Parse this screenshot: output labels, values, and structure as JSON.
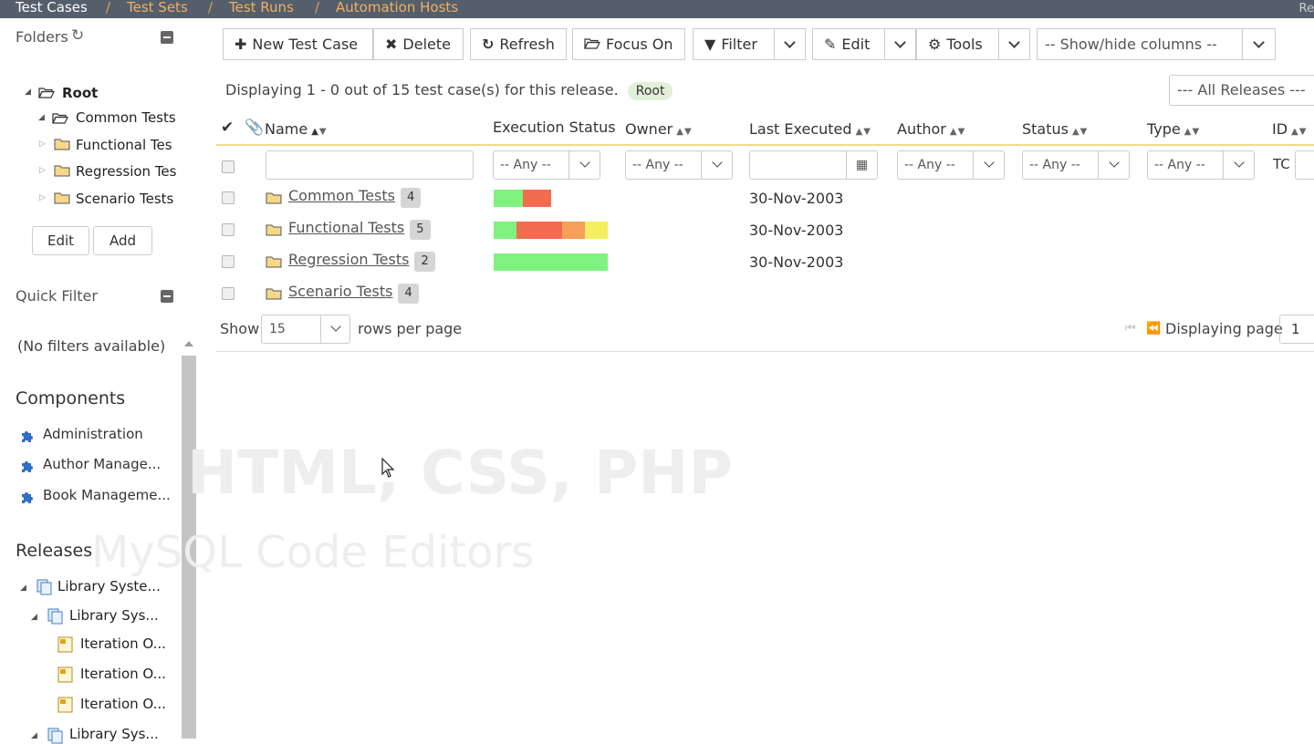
{
  "topnav": {
    "items": [
      "Test Cases",
      "Test Sets",
      "Test Runs",
      "Automation Hosts"
    ],
    "separator": "/",
    "right_text": "Re"
  },
  "sidebar": {
    "folders_title": "Folders",
    "refresh_glyph": "↻",
    "tree": [
      {
        "label": "Root"
      },
      {
        "label": "Common Tests"
      },
      {
        "label": "Functional Tes"
      },
      {
        "label": "Regression Tes"
      },
      {
        "label": "Scenario Tests"
      }
    ],
    "edit_label": "Edit",
    "add_label": "Add",
    "quick_filter_title": "Quick Filter",
    "no_filters": "(No filters available)",
    "components_title": "Components",
    "components": [
      "Administration",
      "Author Manage...",
      "Book Manageme..."
    ],
    "releases_title": "Releases",
    "releases": [
      "Library Syste...",
      "Library Sys...",
      "Iteration O...",
      "Iteration O...",
      "Iteration O...",
      "Library Sys..."
    ]
  },
  "toolbar": {
    "new_test_case": "New Test Case",
    "delete": "Delete",
    "refresh": "Refresh",
    "focus_on": "Focus On",
    "filter": "Filter",
    "edit": "Edit",
    "tools": "Tools",
    "show_hide": "-- Show/hide columns --"
  },
  "summary": {
    "text": "Displaying 1 - 0 out of 15 test case(s) for this release.",
    "root_badge": "Root",
    "releases_select": "--- All Releases ---"
  },
  "grid": {
    "columns": {
      "name": "Name",
      "execution_status": "Execution Status",
      "owner": "Owner",
      "last_executed": "Last Executed",
      "author": "Author",
      "status": "Status",
      "type": "Type",
      "id": "ID"
    },
    "filters": {
      "any": "-- Any --",
      "id_prefix": "TC"
    },
    "rows": [
      {
        "name": "Common Tests",
        "count": "4",
        "last_executed": "30-Nov-2003"
      },
      {
        "name": "Functional Tests",
        "count": "5",
        "last_executed": "30-Nov-2003"
      },
      {
        "name": "Regression Tests",
        "count": "2",
        "last_executed": "30-Nov-2003"
      },
      {
        "name": "Scenario Tests",
        "count": "4",
        "last_executed": ""
      }
    ]
  },
  "execution_status_shares": [
    [
      {
        "status": "passed",
        "share": 0.5
      },
      {
        "status": "failed",
        "share": 0.5
      }
    ],
    [
      {
        "status": "passed",
        "share": 0.2
      },
      {
        "status": "failed",
        "share": 0.4
      },
      {
        "status": "caution",
        "share": 0.2
      },
      {
        "status": "blocked",
        "share": 0.2
      }
    ],
    [
      {
        "status": "passed",
        "share": 1.0
      }
    ],
    []
  ],
  "status_colors": {
    "passed": "#7ef27e",
    "failed": "#f36c4f",
    "caution": "#f6a05a",
    "blocked": "#f4ee60"
  },
  "pager": {
    "show": "Show",
    "rows_value": "15",
    "rows_per_page": "rows per page",
    "displaying_page": "Displaying page",
    "page_value": "1"
  },
  "overlay": {
    "line1": "HTML, CSS, PHP",
    "line2": "MySQL Code Editors"
  }
}
